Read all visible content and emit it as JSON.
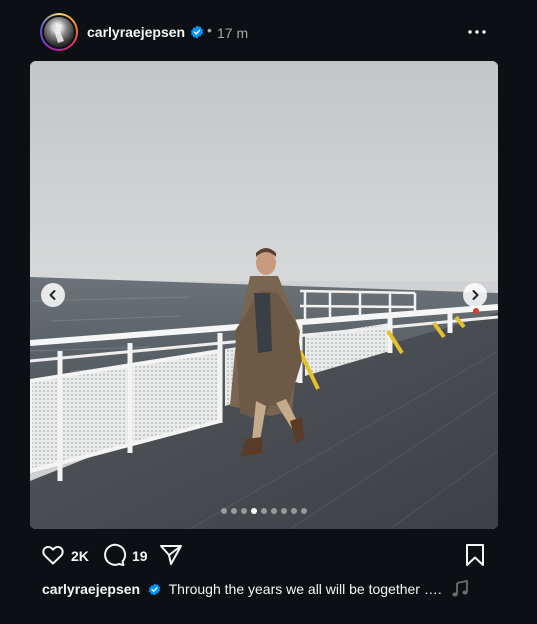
{
  "header": {
    "username": "carlyraejepsen",
    "separator": "•",
    "time": "17 m"
  },
  "carousel": {
    "total": 9,
    "active_index": 3
  },
  "actions": {
    "likes": "2K",
    "comments": "19"
  },
  "caption": {
    "username": "carlyraejepsen",
    "text": "Through the years we all will be together …."
  },
  "colors": {
    "background": "#0c1014",
    "verified": "#0095f6"
  }
}
